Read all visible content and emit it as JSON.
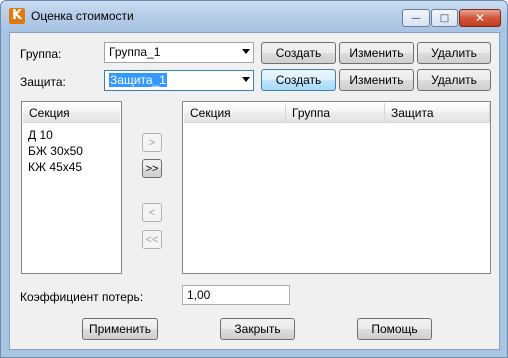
{
  "window": {
    "title": "Оценка стоимости",
    "app_icon": "K",
    "minimize_glyph": "—",
    "maximize_glyph": "□",
    "close_glyph": "✕"
  },
  "group": {
    "label": "Группа:",
    "selected": "Группа_1",
    "create_label": "Создать",
    "edit_label": "Изменить",
    "delete_label": "Удалить"
  },
  "protection": {
    "label": "Защита:",
    "selected": "Защита_1",
    "create_label": "Создать",
    "edit_label": "Изменить",
    "delete_label": "Удалить"
  },
  "sections_list": {
    "header": "Секция",
    "items": [
      "Д 10",
      "БЖ 30х50",
      "КЖ 45х45"
    ]
  },
  "transfer": {
    "add_one": ">",
    "add_all": ">>",
    "remove_one": "<",
    "remove_all": "<<"
  },
  "selected_table": {
    "columns": [
      "Секция",
      "Группа",
      "Защита"
    ]
  },
  "loss_coefficient": {
    "label": "Коэффициент потерь:",
    "value": "1,00"
  },
  "footer": {
    "apply_label": "Применить",
    "close_label": "Закрыть",
    "help_label": "Помощь"
  }
}
